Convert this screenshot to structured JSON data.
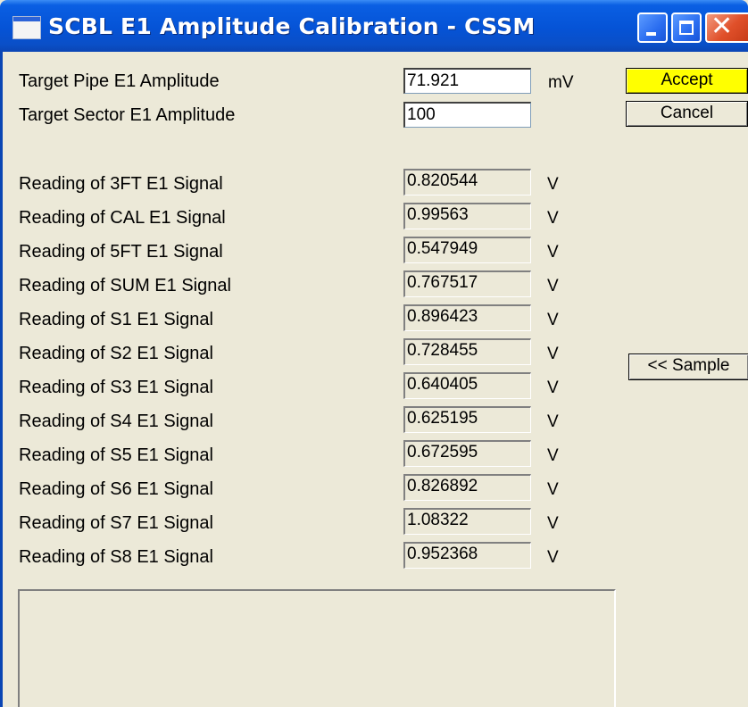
{
  "window": {
    "title": "SCBL E1 Amplitude Calibration - CSSM"
  },
  "targets": [
    {
      "label": "Target Pipe E1 Amplitude",
      "value": "71.921",
      "unit": "mV"
    },
    {
      "label": "Target Sector E1 Amplitude",
      "value": "100",
      "unit": ""
    }
  ],
  "readings": [
    {
      "label": "Reading of 3FT E1 Signal",
      "value": "0.820544",
      "unit": "V"
    },
    {
      "label": "Reading of CAL E1 Signal",
      "value": "0.99563",
      "unit": "V"
    },
    {
      "label": "Reading of 5FT E1 Signal",
      "value": "0.547949",
      "unit": "V"
    },
    {
      "label": "Reading of SUM E1 Signal",
      "value": "0.767517",
      "unit": "V"
    },
    {
      "label": "Reading of S1 E1 Signal",
      "value": "0.896423",
      "unit": "V"
    },
    {
      "label": "Reading of S2 E1 Signal",
      "value": "0.728455",
      "unit": "V"
    },
    {
      "label": "Reading of S3 E1 Signal",
      "value": "0.640405",
      "unit": "V"
    },
    {
      "label": "Reading of S4 E1 Signal",
      "value": "0.625195",
      "unit": "V"
    },
    {
      "label": "Reading of S5 E1 Signal",
      "value": "0.672595",
      "unit": "V"
    },
    {
      "label": "Reading of S6 E1 Signal",
      "value": "0.826892",
      "unit": "V"
    },
    {
      "label": "Reading of S7 E1 Signal",
      "value": "1.08322",
      "unit": "V"
    },
    {
      "label": "Reading of S8 E1 Signal",
      "value": "0.952368",
      "unit": "V"
    }
  ],
  "buttons": {
    "accept": "Accept",
    "cancel": "Cancel",
    "sample": "<< Sample"
  },
  "colors": {
    "accept_bg": "#ffff00",
    "titlebar": "#0553d6",
    "window_bg": "#ece9d8"
  }
}
